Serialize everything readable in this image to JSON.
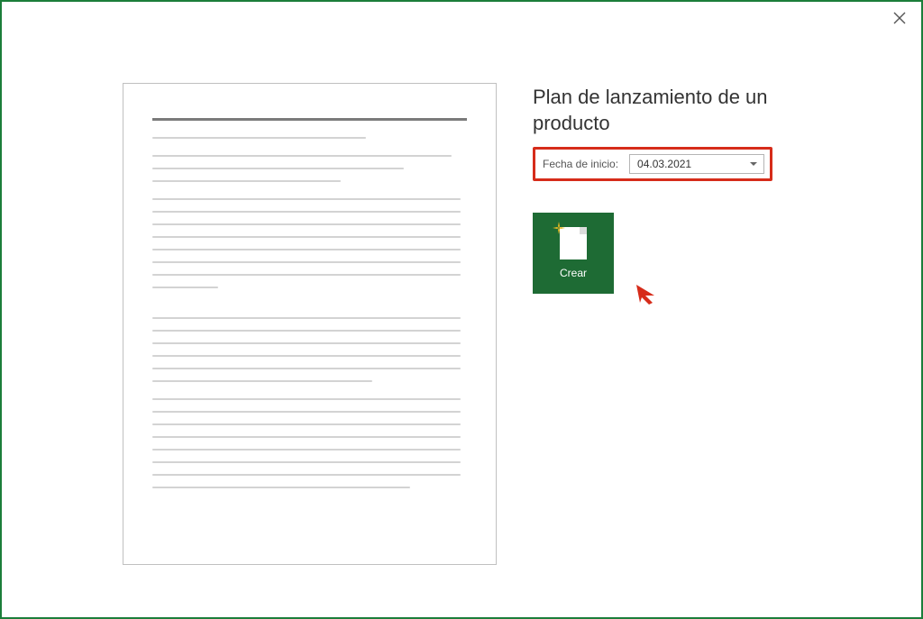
{
  "dialog": {
    "title": "Plan de lanzamiento de un producto",
    "start_date_label": "Fecha de inicio:",
    "start_date_value": "04.03.2021",
    "create_label": "Crear"
  },
  "colors": {
    "accent_green": "#1e6b34",
    "highlight_red": "#d62c1a"
  }
}
